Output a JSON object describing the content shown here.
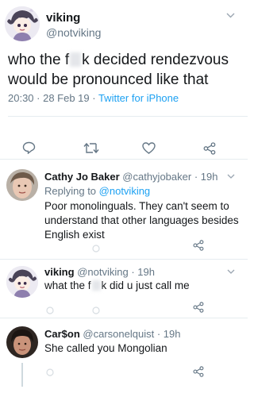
{
  "main_tweet": {
    "name": "viking",
    "handle": "@notviking",
    "text_line1_a": "who the f",
    "text_line1_b": "k decided rendezvous",
    "text_line2": "would be pronounced like that",
    "time": "20:30 · 28 Feb 19 · ",
    "source": "Twitter for iPhone",
    "chevron_icon": "chevron-down-icon",
    "actions": [
      "reply-icon",
      "retweet-icon",
      "like-icon",
      "share-icon"
    ]
  },
  "replies": [
    {
      "name": "Cathy Jo Baker",
      "handle": "@cathyjobaker",
      "age": "· 19h",
      "replying_prefix": "Replying to ",
      "replying_to": "@notviking",
      "text": "Poor monolinguals. They can't seem to understand that other languages besides English exist"
    },
    {
      "name": "viking",
      "handle": "@notviking",
      "age": "· 19h",
      "text_a": "what the f",
      "text_b": "k did u just call me"
    },
    {
      "name": "Car$on",
      "handle": "@carsonelquist",
      "age": "· 19h",
      "text": "She called you Mongolian"
    }
  ],
  "colors": {
    "link": "#1da1f2",
    "secondary_text": "#657786",
    "divider": "#e6ecf0"
  }
}
